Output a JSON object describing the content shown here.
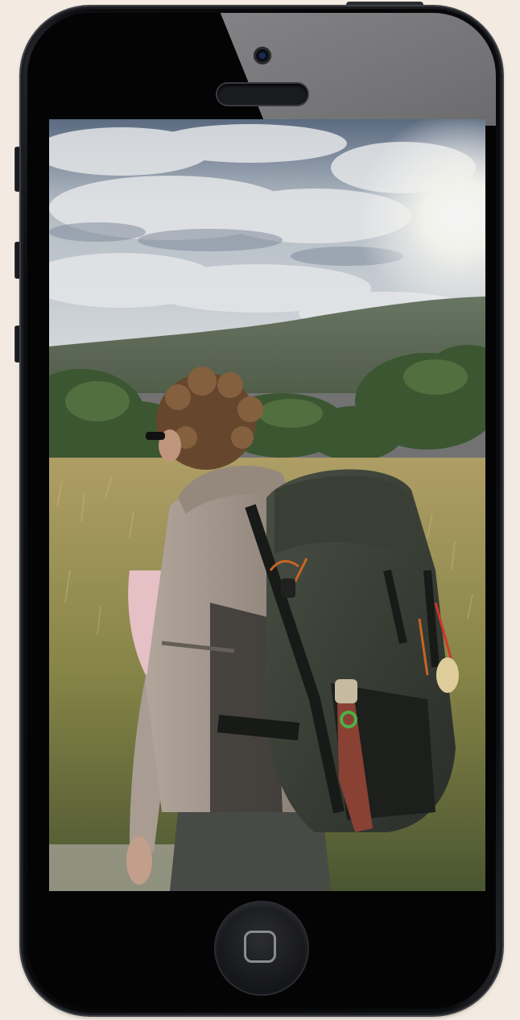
{
  "device": {
    "type": "smartphone",
    "colors": {
      "body": "#050506",
      "bezel_glare": "#7a7a7c",
      "background": "#f3ebe1"
    }
  },
  "screen": {
    "content": "video-frame",
    "description_icons": [
      "camera-icon",
      "speaker-icon",
      "home-button-icon"
    ]
  }
}
